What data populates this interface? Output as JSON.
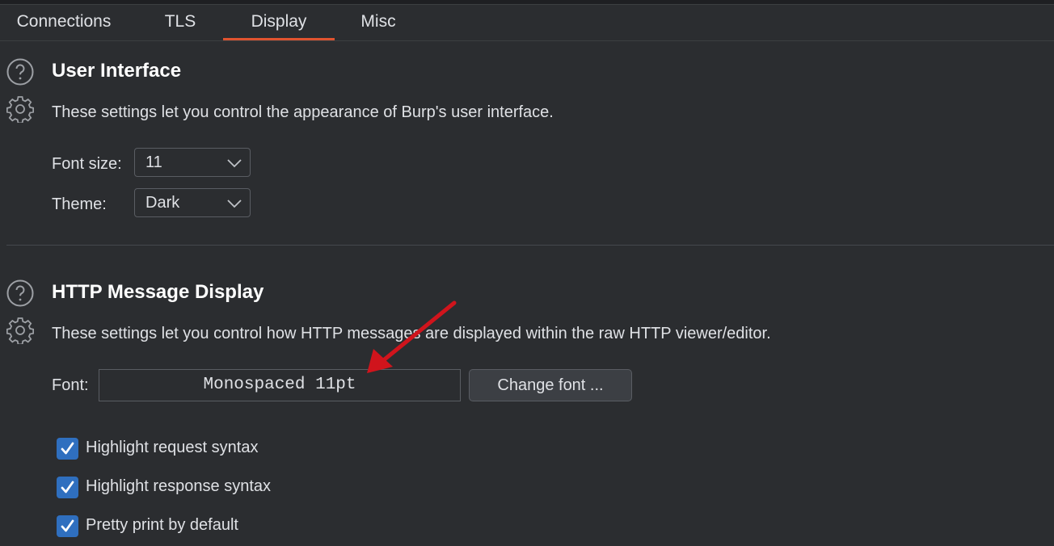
{
  "tabs": [
    {
      "label": "Connections",
      "active": false
    },
    {
      "label": "TLS",
      "active": false
    },
    {
      "label": "Display",
      "active": true
    },
    {
      "label": "Misc",
      "active": false
    }
  ],
  "user_interface": {
    "title": "User Interface",
    "description": "These settings let you control the appearance of Burp's user interface.",
    "font_size_label": "Font size:",
    "font_size_value": "11",
    "theme_label": "Theme:",
    "theme_value": "Dark"
  },
  "http_display": {
    "title": "HTTP Message Display",
    "description": "These settings let you control how HTTP messages are displayed within the raw HTTP viewer/editor.",
    "font_label": "Font:",
    "font_value": "Monospaced 11pt",
    "change_font_button": "Change font ...",
    "checkboxes": [
      {
        "label": "Highlight request syntax",
        "checked": true
      },
      {
        "label": "Highlight response syntax",
        "checked": true
      },
      {
        "label": "Pretty print by default",
        "checked": true
      }
    ]
  },
  "colors": {
    "background": "#2b2d30",
    "accent_tab": "#e0532f",
    "checkbox": "#2f6fbf",
    "annotation_arrow": "#d0141c"
  },
  "icons": [
    "help-icon",
    "settings-gear-icon",
    "chevron-down-icon",
    "checkmark-icon",
    "annotation-arrow"
  ]
}
